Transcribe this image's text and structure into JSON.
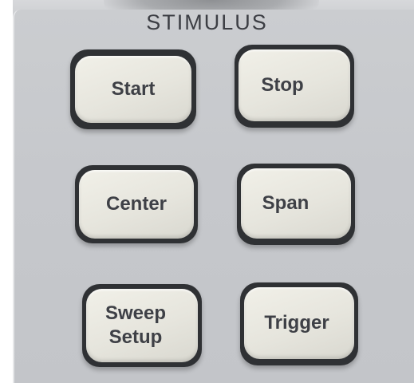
{
  "panel": {
    "section_title": "STIMULUS"
  },
  "keys": {
    "start": "Start",
    "stop": "Stop",
    "center": "Center",
    "span": "Span",
    "sweep_setup": "Sweep\nSetup",
    "trigger": "Trigger"
  },
  "colors": {
    "panel_face": "#c6c8cc",
    "key_face": "#e6e5dd",
    "key_text": "#3e4046",
    "key_well": "#2f3134"
  }
}
